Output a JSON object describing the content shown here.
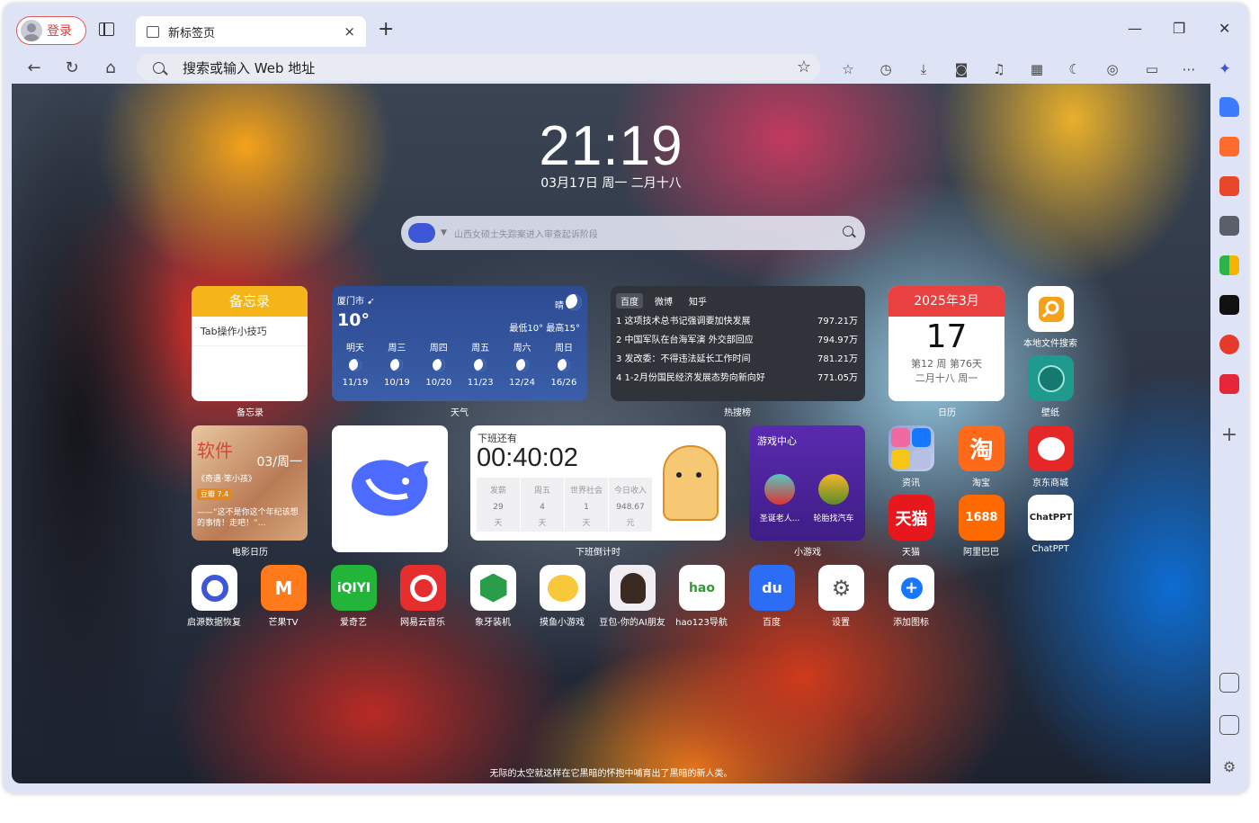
{
  "titlebar": {
    "login_label": "登录",
    "tab_label": "新标签页",
    "tab_close": "×",
    "new_tab": "+",
    "min": "—",
    "max": "❐",
    "close": "✕"
  },
  "address": {
    "placeholder": "搜索或输入 Web 地址"
  },
  "clock": {
    "time": "21:19",
    "date": "03月17日 周一 二月十八"
  },
  "search": {
    "query": "山西女硕士失踪案进入审查起诉阶段"
  },
  "memo": {
    "title": "备忘录",
    "item": "Tab操作小技巧",
    "caption": "备忘录"
  },
  "weather": {
    "city": "厦门市",
    "temp": "10°",
    "cond": "晴",
    "range": "最低10° 最高15°",
    "caption": "天气",
    "days": [
      {
        "name": "明天",
        "date": "11/19"
      },
      {
        "name": "周三",
        "date": "10/19"
      },
      {
        "name": "周四",
        "date": "10/20"
      },
      {
        "name": "周五",
        "date": "11/23"
      },
      {
        "name": "周六",
        "date": "12/24"
      },
      {
        "name": "周日",
        "date": "16/26"
      }
    ]
  },
  "hot": {
    "tabs": [
      "百度",
      "微博",
      "知乎"
    ],
    "caption": "热搜榜",
    "rows": [
      {
        "t": "1 这项技术总书记强调要加快发展",
        "v": "797.21万"
      },
      {
        "t": "2 中国军队在台海军演 外交部回应",
        "v": "794.97万"
      },
      {
        "t": "3 发改委：不得违法延长工作时间",
        "v": "781.21万"
      },
      {
        "t": "4 1-2月份国民经济发展态势向新向好",
        "v": "771.05万"
      }
    ]
  },
  "calendar": {
    "month": "2025年3月",
    "day": "17",
    "week": "第12 周 第76天",
    "lunar": "二月十八  周一",
    "caption": "日历"
  },
  "movie": {
    "title": "软件",
    "date": "03/周一",
    "sub": "《奇遇·笨小孩》",
    "rating": "豆瓣 7.4",
    "quote": "——“这不是你这个年纪该想的事情！走吧！”…",
    "caption": "电影日历"
  },
  "countdown": {
    "title": "下班还有",
    "time": "00:40:02",
    "caption": "下班倒计时",
    "cols": [
      {
        "h": "发薪",
        "v": "29",
        "u": "天"
      },
      {
        "h": "周五",
        "v": "4",
        "u": "天"
      },
      {
        "h": "世界社会",
        "v": "1",
        "u": "天"
      },
      {
        "h": "今日收入",
        "v": "948.67",
        "u": "元"
      }
    ]
  },
  "games": {
    "title": "游戏中心",
    "g1": "圣诞老人...",
    "g2": "轮胎找汽车",
    "caption": "小游戏"
  },
  "right_icons": {
    "local_search": "本地文件搜索",
    "wallpaper": "壁纸",
    "news": "资讯",
    "taobao": "淘宝",
    "jd": "京东商城",
    "tmall": "天猫",
    "alibaba": "阿里巴巴",
    "chatppt": "ChatPPT"
  },
  "bottom_icons": [
    "启源数据恢复",
    "芒果TV",
    "爱奇艺",
    "网易云音乐",
    "象牙装机",
    "摸鱼小游戏",
    "豆包-你的AI朋友",
    "hao123导航",
    "百度",
    "设置",
    "添加图标"
  ],
  "footer": "无际的太空就这样在它黑暗的怀抱中哺育出了黑暗的新人类。",
  "colors": {
    "memo": "#f5b418",
    "calendar": "#e94040",
    "game": "#4a24a0",
    "taobao": "#ff6a1a",
    "jd": "#e62727"
  }
}
